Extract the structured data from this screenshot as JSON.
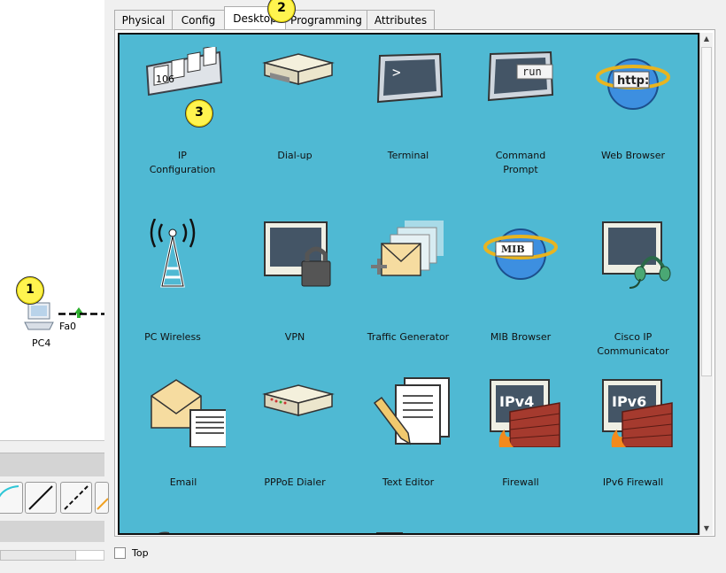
{
  "workspace": {
    "device_label": "PC4",
    "port_label": "Fa0"
  },
  "badges": {
    "one": "1",
    "two": "2",
    "three": "3"
  },
  "tabs": [
    {
      "label": "Physical"
    },
    {
      "label": "Config"
    },
    {
      "label": "Desktop"
    },
    {
      "label": "Programming"
    },
    {
      "label": "Attributes"
    }
  ],
  "desktop_apps": [
    {
      "label": "IP\nConfiguration",
      "icon": "ip-configuration-icon"
    },
    {
      "label": "Dial-up",
      "icon": "modem-icon"
    },
    {
      "label": "Terminal",
      "icon": "terminal-icon"
    },
    {
      "label": "Command\nPrompt",
      "icon": "command-prompt-icon"
    },
    {
      "label": "Web Browser",
      "icon": "web-browser-icon"
    },
    {
      "label": "PC Wireless",
      "icon": "wireless-tower-icon"
    },
    {
      "label": "VPN",
      "icon": "vpn-lock-icon"
    },
    {
      "label": "Traffic Generator",
      "icon": "traffic-generator-icon"
    },
    {
      "label": "MIB Browser",
      "icon": "mib-browser-icon"
    },
    {
      "label": "Cisco IP Communicator",
      "icon": "headset-icon"
    },
    {
      "label": "Email",
      "icon": "email-icon"
    },
    {
      "label": "PPPoE Dialer",
      "icon": "pppoe-dialer-icon"
    },
    {
      "label": "Text Editor",
      "icon": "text-editor-icon"
    },
    {
      "label": "Firewall",
      "icon": "firewall-icon"
    },
    {
      "label": "IPv6 Firewall",
      "icon": "ipv6-firewall-icon"
    }
  ],
  "icon_text": {
    "ip_config": "106",
    "command": "run",
    "browser": "http:",
    "mib": "MIB",
    "firewall": "IPv4",
    "ipv6_firewall": "IPv6"
  },
  "bottom": {
    "top_checkbox_label": "Top"
  },
  "colors": {
    "grid_background": "#4fb9d3",
    "badge": "#fff44f"
  }
}
